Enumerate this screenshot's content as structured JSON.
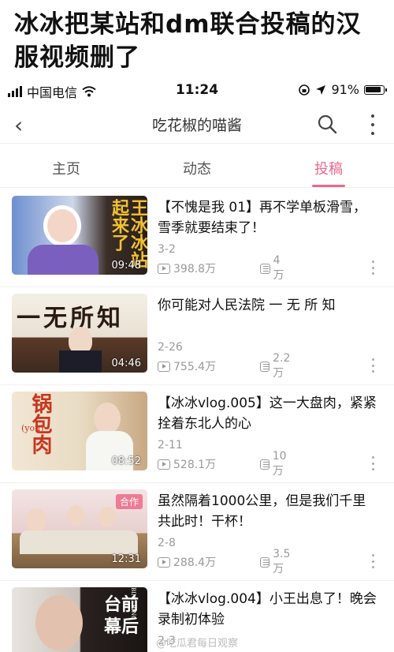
{
  "headline": "冰冰把某站和dm联合投稿的汉服视频删了",
  "status_bar": {
    "carrier": "中国电信",
    "time": "11:24",
    "battery": "91%"
  },
  "navbar": {
    "back_icon": "chevron-left-icon",
    "title": "吃花椒的喵酱",
    "search_icon": "search-icon",
    "more_icon": "more-vertical-icon"
  },
  "tabs": [
    {
      "label": "主页",
      "active": false
    },
    {
      "label": "动态",
      "active": false
    },
    {
      "label": "投稿",
      "active": true
    }
  ],
  "accent_color": "#e8698d",
  "videos": [
    {
      "title": "【不愧是我 01】再不学单板滑雪，雪季就要结束了！",
      "date": "3-2",
      "views": "398.8万",
      "danmaku": "4万",
      "duration": "09:48",
      "thumb_text": "王冰冰站起来了",
      "badge": ""
    },
    {
      "title": "你可能对人民法院 一 无 所 知",
      "date": "2-26",
      "views": "755.4万",
      "danmaku": "2.2万",
      "duration": "04:46",
      "thumb_text": "一无所知",
      "badge": ""
    },
    {
      "title": "【冰冰vlog.005】这一大盘肉，紧紧拴着东北人的心",
      "date": "2-11",
      "views": "528.1万",
      "danmaku": "10万",
      "duration": "08:52",
      "thumb_text": "锅包肉",
      "thumb_subtext": "(you)",
      "badge": ""
    },
    {
      "title": "虽然隔着1000公里，但是我们千里共此时！干杯！",
      "date": "2-8",
      "views": "288.4万",
      "danmaku": "3.5万",
      "duration": "12:31",
      "thumb_text": "",
      "badge": "合作"
    },
    {
      "title": "【冰冰vlog.004】小王出息了！晚会录制初体验",
      "date": "2-3",
      "views": "",
      "danmaku": "",
      "duration": "",
      "thumb_text": "台前幕后",
      "thumb_subtext": "BING BING",
      "badge": ""
    }
  ],
  "watermark": "@吃瓜君每日观察"
}
